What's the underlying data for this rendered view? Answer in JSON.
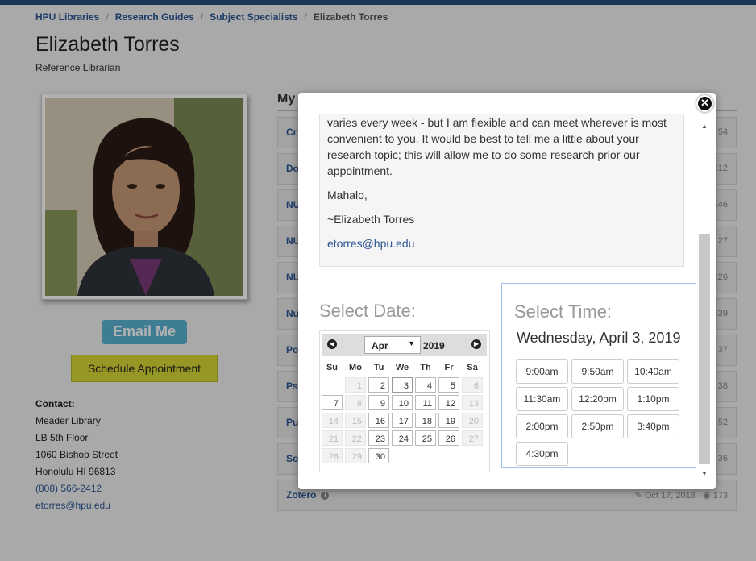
{
  "breadcrumb": {
    "items": [
      "HPU Libraries",
      "Research Guides",
      "Subject Specialists"
    ],
    "current": "Elizabeth Torres",
    "separator": "/"
  },
  "profile": {
    "name": "Elizabeth Torres",
    "title": "Reference Librarian",
    "email_button": "Email Me",
    "schedule_button": "Schedule Appointment"
  },
  "contact": {
    "heading": "Contact:",
    "lines": [
      "Meader Library",
      "LB 5th Floor",
      "1060 Bishop Street",
      "Honolulu HI 96813"
    ],
    "phone": "(808) 566-2412",
    "email": "etorres@hpu.edu"
  },
  "guides": {
    "heading": "My",
    "rows": [
      {
        "title": "Cr",
        "count": "54"
      },
      {
        "title": "Do",
        "count": "312"
      },
      {
        "title": "NU",
        "count": "246"
      },
      {
        "title": "NU",
        "count": "27"
      },
      {
        "title": "NU",
        "count": "226"
      },
      {
        "title": "Nu",
        "count": "239"
      },
      {
        "title": "Po",
        "count": "37"
      },
      {
        "title": "Ps",
        "count": "38"
      },
      {
        "title": "Pu",
        "count": "52"
      },
      {
        "title": "So",
        "count": "36"
      }
    ],
    "last": {
      "title": "Zotero",
      "date": "Oct 17, 2018",
      "views": "173"
    }
  },
  "modal": {
    "message": [
      "varies every week - but I am flexible and can meet wherever is most convenient to you.  It would be best to tell me a little about your research  topic; this will allow me to do some research prior our appointment.",
      "Mahalo,",
      "~Elizabeth Torres"
    ],
    "email_link": "etorres@hpu.edu",
    "select_date_label": "Select Date:",
    "select_time_label": "Select Time:",
    "calendar": {
      "month": "Apr",
      "year": "2019",
      "weekdays": [
        "Su",
        "Mo",
        "Tu",
        "We",
        "Th",
        "Fr",
        "Sa"
      ],
      "weeks": [
        [
          "",
          "1",
          "2",
          "3",
          "4",
          "5",
          "6"
        ],
        [
          "7",
          "8",
          "9",
          "10",
          "11",
          "12",
          "13"
        ],
        [
          "14",
          "15",
          "16",
          "17",
          "18",
          "19",
          "20"
        ],
        [
          "21",
          "22",
          "23",
          "24",
          "25",
          "26",
          "27"
        ],
        [
          "28",
          "29",
          "30",
          "",
          "",
          "",
          ""
        ]
      ],
      "available": [
        "2",
        "3",
        "4",
        "5",
        "7",
        "9",
        "10",
        "11",
        "12",
        "16",
        "17",
        "18",
        "19",
        "23",
        "24",
        "25",
        "26",
        "30"
      ],
      "selected": "3"
    },
    "selected_date": "Wednesday, April 3, 2019",
    "times": [
      "9:00am",
      "9:50am",
      "10:40am",
      "11:30am",
      "12:20pm",
      "1:10pm",
      "2:00pm",
      "2:50pm",
      "3:40pm",
      "4:30pm"
    ]
  },
  "colors": {
    "link": "#2b5694",
    "email_button": "#5bb5d2",
    "schedule_button": "#d8d836",
    "overlay": "rgba(0,0,0,0.3)"
  }
}
